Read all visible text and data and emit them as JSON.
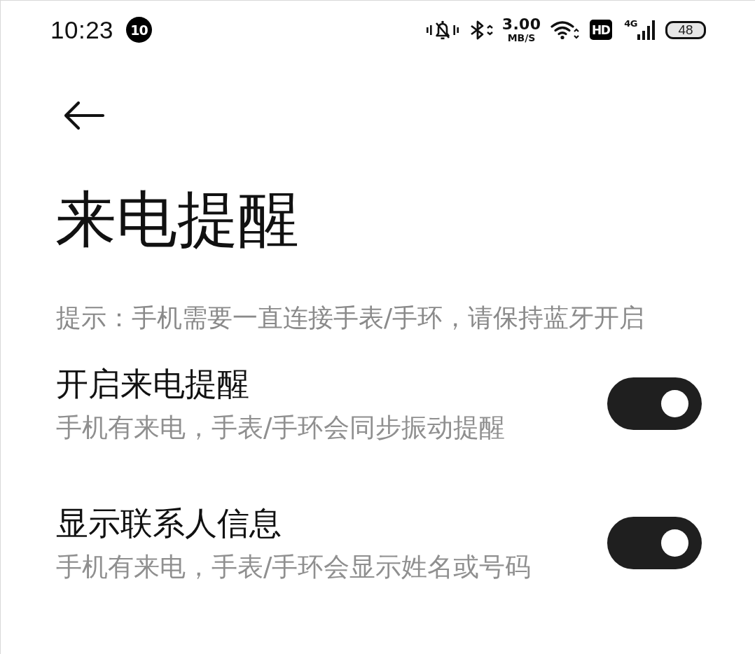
{
  "status_bar": {
    "time": "10:23",
    "notification_count": "10",
    "net_speed": {
      "value": "3.00",
      "unit": "MB/S"
    },
    "hd_label": "HD",
    "network_type": "4G",
    "battery": "48"
  },
  "title": "来电提醒",
  "hint": "提示：手机需要一直连接手表/手环，请保持蓝牙开启",
  "settings": [
    {
      "title": "开启来电提醒",
      "description": "手机有来电，手表/手环会同步振动提醒",
      "on": true
    },
    {
      "title": "显示联系人信息",
      "description": "手机有来电，手表/手环会显示姓名或号码",
      "on": true
    }
  ]
}
